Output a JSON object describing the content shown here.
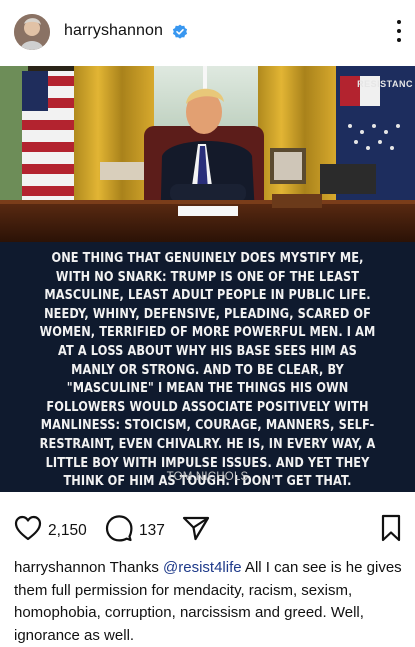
{
  "header": {
    "username": "harryshannon",
    "verified_icon": "verified-badge-icon",
    "more_icon": "more-options-icon"
  },
  "post": {
    "watermark": "RESISTANC",
    "quote": "ONE THING THAT GENUINELY DOES MYSTIFY ME, WITH NO SNARK: TRUMP IS ONE OF THE LEAST MASCULINE, LEAST ADULT PEOPLE IN PUBLIC LIFE. NEEDY, WHINY, DEFENSIVE, PLEADING, SCARED OF WOMEN, TERRIFIED OF MORE POWERFUL MEN. I AM AT A LOSS ABOUT WHY HIS BASE SEES HIM AS MANLY OR STRONG. AND TO BE CLEAR, BY \"MASCULINE\" I MEAN THE THINGS HIS OWN FOLLOWERS WOULD ASSOCIATE POSITIVELY WITH MANLINESS: STOICISM, COURAGE, MANNERS, SELF-RESTRAINT, EVEN CHIVALRY. HE IS, IN EVERY WAY, A LITTLE BOY WITH IMPULSE ISSUES. AND YET THEY THINK OF HIM AS TOUGH. I DON'T GET THAT.",
    "author": "TOM NICHOLS"
  },
  "actions": {
    "likes": "2,150",
    "comments": "137",
    "like_icon": "heart-icon",
    "comment_icon": "comment-bubble-icon",
    "share_icon": "send-icon",
    "save_icon": "bookmark-icon"
  },
  "caption": {
    "username": "harryshannon",
    "text_before": "Thanks ",
    "mention": "@resist4life",
    "text_after": " All I can see is he gives them full permission for mendacity, racism, sexism, homophobia, corruption, narcissism and greed. Well, ignorance as well."
  },
  "colors": {
    "verified": "#3897f0",
    "mention": "#1e3a8a",
    "quote_bg": "#0f1a2e"
  }
}
